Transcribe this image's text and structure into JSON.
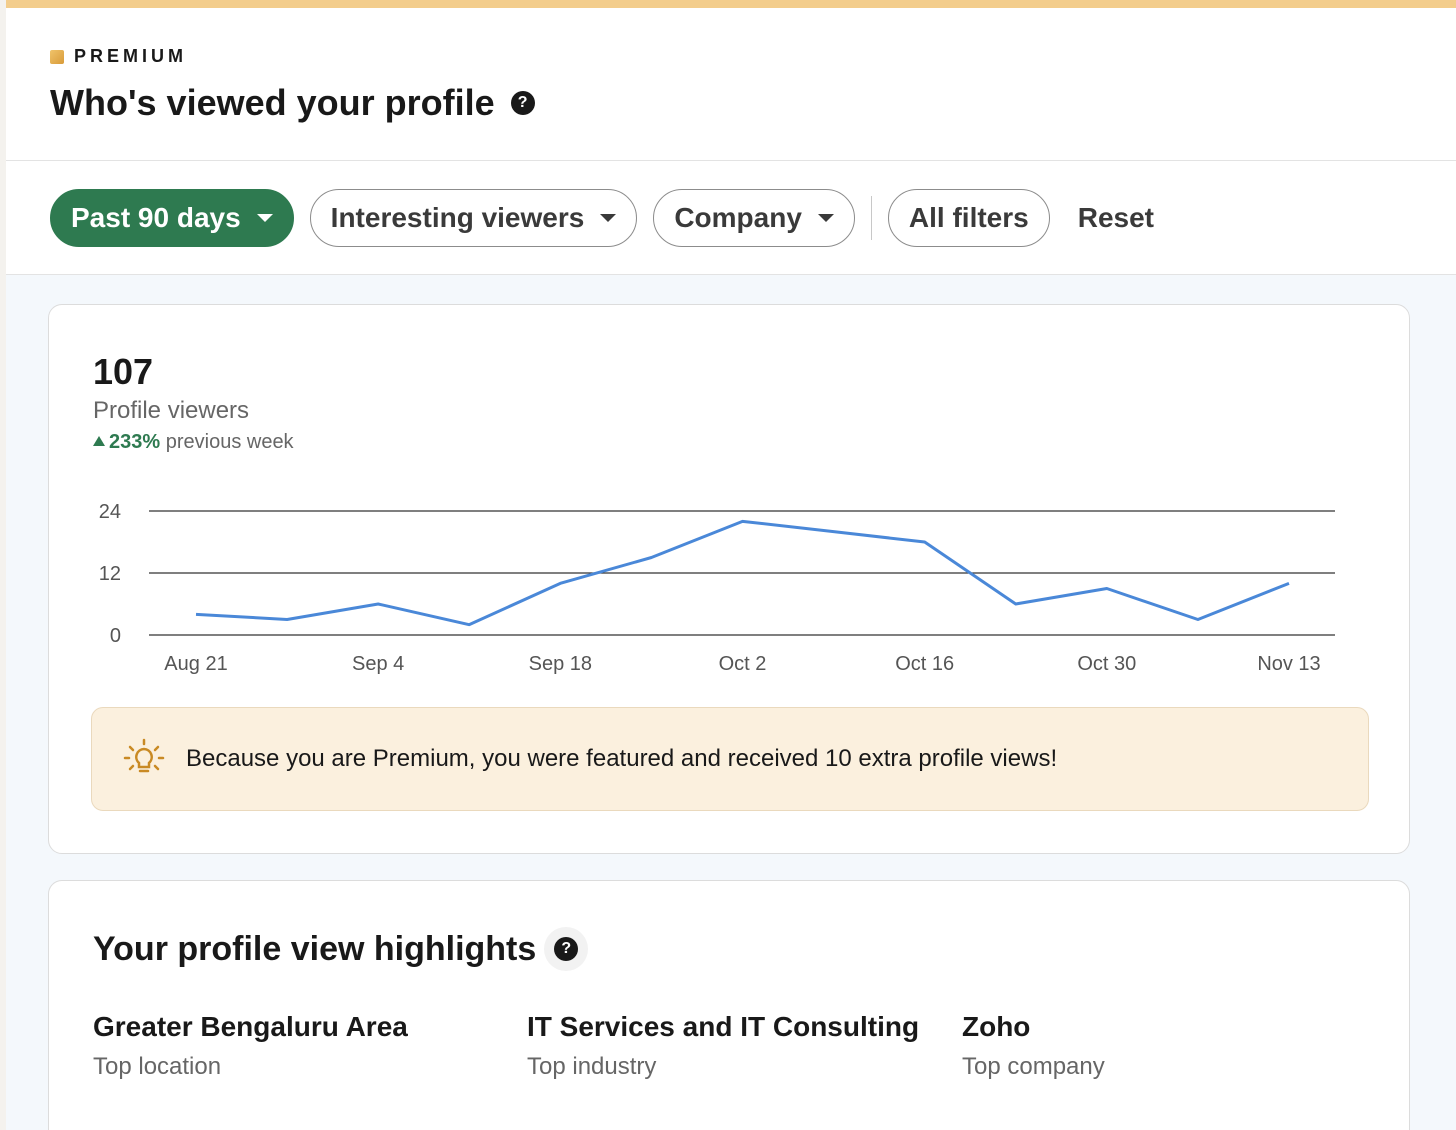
{
  "header": {
    "brand": "PREMIUM",
    "title": "Who's viewed your profile"
  },
  "filters": {
    "range": "Past 90 days",
    "viewers": "Interesting viewers",
    "company": "Company",
    "all": "All filters",
    "reset": "Reset"
  },
  "summary": {
    "count": "107",
    "label": "Profile viewers",
    "delta_value": "233%",
    "delta_text": "previous week"
  },
  "chart_data": {
    "type": "line",
    "x": [
      "Aug 21",
      "Aug 28",
      "Sep 4",
      "Sep 11",
      "Sep 18",
      "Sep 25",
      "Oct 2",
      "Oct 9",
      "Oct 16",
      "Oct 23",
      "Oct 30",
      "Nov 6",
      "Nov 13"
    ],
    "tick_labels": [
      "Aug 21",
      "Sep 4",
      "Sep 18",
      "Oct 2",
      "Oct 16",
      "Oct 30",
      "Nov 13"
    ],
    "values": [
      4,
      3,
      6,
      2,
      10,
      15,
      22,
      20,
      18,
      6,
      9,
      3,
      10
    ],
    "ylim": [
      0,
      24
    ],
    "yticks": [
      0,
      12,
      24
    ],
    "grid": true,
    "line_color": "#4a88d8"
  },
  "notice": {
    "text": "Because you are Premium, you were featured and received 10 extra profile views!"
  },
  "highlights": {
    "title": "Your profile view highlights",
    "items": [
      {
        "value": "Greater Bengaluru Area",
        "label": "Top location"
      },
      {
        "value": "IT Services and IT Consulting",
        "label": "Top industry"
      },
      {
        "value": "Zoho",
        "label": "Top company"
      }
    ]
  },
  "colors": {
    "accent_green": "#2e7a50",
    "premium_gold": "#f3cd8c",
    "notice_bg": "#fbf0de"
  }
}
